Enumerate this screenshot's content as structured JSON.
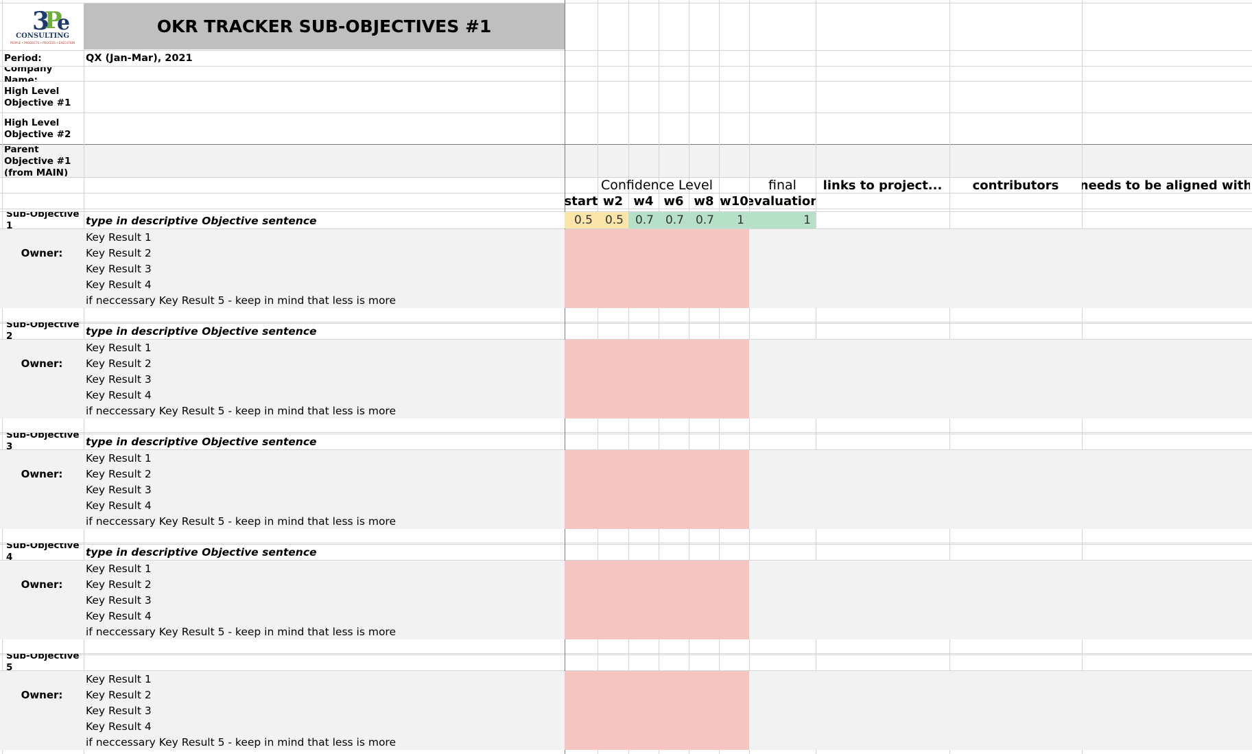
{
  "header": {
    "logo": {
      "text": "3Pe",
      "sub": "CONSULTING",
      "tagline": "PEOPLE • PRODUCTS • PROCESS • EXECUTION"
    },
    "title": "OKR TRACKER SUB-OBJECTIVES #1"
  },
  "info": {
    "period_label": "Period:",
    "period_value": "QX (Jan-Mar), 2021",
    "company_label": "Company Name:",
    "hlo1_label": "High Level Objective #1",
    "hlo2_label": "High Level Objective #2",
    "parent_label": "Parent Objective #1 (from MAIN)"
  },
  "columns": {
    "confidence_label": "Confidence Level",
    "final_top": "final",
    "final_bottom": "evaluation",
    "links": "links to project...",
    "contributors": "contributors",
    "aligned": "needs to be aligned with",
    "weeks": [
      "start",
      "w2",
      "w4",
      "w6",
      "w8",
      "w10"
    ]
  },
  "colors": {
    "title_bg": "#bfbfbf",
    "band_bg": "#f2f2f2",
    "yellow": "#fbe5a9",
    "green": "#b6e0c8",
    "pink": "#f4c5c1"
  },
  "sub_objectives": [
    {
      "label": "Sub-Objective 1",
      "objective": "type in descriptive Objective sentence",
      "owner_label": "Owner:",
      "confidence": [
        "0.5",
        "0.5",
        "0.7",
        "0.7",
        "0.7",
        "1"
      ],
      "final": "1",
      "key_results": [
        "Key Result 1",
        "Key Result 2",
        "Key Result 3",
        "Key Result 4",
        "if neccessary Key Result 5 - keep in mind that less is more"
      ]
    },
    {
      "label": "Sub-Objective 2",
      "objective": "type in descriptive Objective sentence",
      "owner_label": "Owner:",
      "confidence": [],
      "final": "",
      "key_results": [
        "Key Result 1",
        "Key Result 2",
        "Key Result 3",
        "Key Result 4",
        "if neccessary Key Result 5 - keep in mind that less is more"
      ]
    },
    {
      "label": "Sub-Objective 3",
      "objective": "type in descriptive Objective sentence",
      "owner_label": "Owner:",
      "confidence": [],
      "final": "",
      "key_results": [
        "Key Result 1",
        "Key Result 2",
        "Key Result 3",
        "Key Result 4",
        "if neccessary Key Result 5 - keep in mind that less is more"
      ]
    },
    {
      "label": "Sub-Objective 4",
      "objective": "type in descriptive Objective sentence",
      "owner_label": "Owner:",
      "confidence": [],
      "final": "",
      "key_results": [
        "Key Result 1",
        "Key Result 2",
        "Key Result 3",
        "Key Result 4",
        "if neccessary Key Result 5 - keep in mind that less is more"
      ]
    },
    {
      "label": "Sub-Objective 5",
      "objective": "",
      "owner_label": "Owner:",
      "confidence": [],
      "final": "",
      "key_results": [
        "Key Result 1",
        "Key Result 2",
        "Key Result 3",
        "Key Result 4",
        "if neccessary Key Result 5 - keep in mind that less is more"
      ]
    }
  ]
}
